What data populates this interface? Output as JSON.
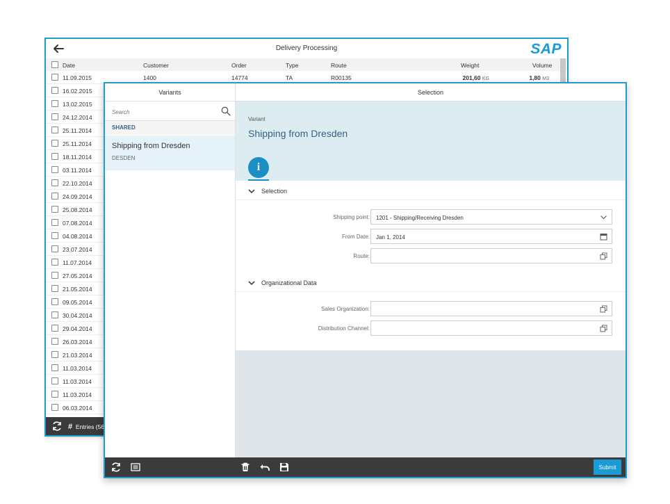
{
  "back_window": {
    "title": "Delivery Processing",
    "logo_text": "SAP",
    "columns": [
      "Date",
      "Customer",
      "Order",
      "Type",
      "Route",
      "Weight",
      "Volume"
    ],
    "first_row": {
      "date": "11.09.2015",
      "customer": "1400",
      "order": "14774",
      "type": "TA",
      "route": "R00135",
      "weight": "201,60",
      "weight_unit": "KG",
      "volume": "1,80",
      "volume_unit": "M3"
    },
    "dates": [
      "16.02.2015",
      "13.02.2015",
      "24.12.2014",
      "25.11.2014",
      "25.11.2014",
      "18.11.2014",
      "03.11.2014",
      "22.10.2014",
      "24.09.2014",
      "25.08.2014",
      "07.08.2014",
      "04.08.2014",
      "23.07.2014",
      "11.07.2014",
      "27.05.2014",
      "21.05.2014",
      "09.05.2014",
      "30.04.2014",
      "29.04.2014",
      "26.03.2014",
      "21.03.2014",
      "11.03.2014",
      "11.03.2014",
      "11.03.2014",
      "06.03.2014"
    ],
    "footer_entries": "Entries (56"
  },
  "variants": {
    "header": "Variants",
    "search_placeholder": "Search",
    "group_label": "SHARED",
    "item_title": "Shipping from Dresden",
    "item_subtitle": "DESDEN"
  },
  "selection": {
    "header": "Selection",
    "object_subtitle": "Variant",
    "object_title": "Shipping from Dresden",
    "info_tab_letter": "i",
    "section1_title": "Selection",
    "shipping_point_label": "Shipping point:",
    "shipping_point_value": "1201 - Shipping/Receiving Dresden",
    "from_date_label": "From Date:",
    "from_date_value": "Jan 1, 2014",
    "route_label": "Route:",
    "route_value": "",
    "section2_title": "Organizational Data",
    "sales_org_label": "Sales Organization:",
    "sales_org_value": "",
    "dist_channel_label": "Distribution Channel:",
    "dist_channel_value": ""
  },
  "footer": {
    "submit_label": "Submit"
  },
  "colors": {
    "accent": "#1a9bd6",
    "window_border": "#1f9cc8",
    "object_header_bg": "#dcecf0",
    "title_blue": "#346187",
    "footer_bg": "#3b3b3b"
  },
  "icons": [
    "back-arrow-icon",
    "search-icon",
    "chevron-down-icon",
    "calendar-icon",
    "value-help-icon",
    "refresh-icon",
    "hash-icon",
    "list-icon",
    "delete-icon",
    "undo-icon",
    "save-icon",
    "info-icon"
  ]
}
